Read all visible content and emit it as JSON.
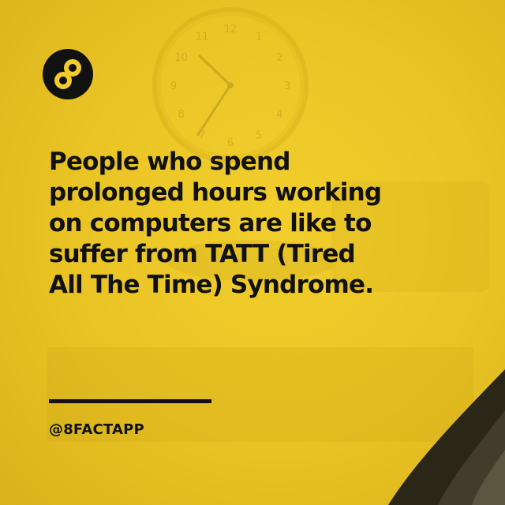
{
  "logo": {
    "icon": "infinity-8-icon",
    "background": "#111111",
    "mark_color": "#f2cc2a"
  },
  "fact": {
    "lines": [
      "People who spend",
      "prolonged hours working",
      "on computers are like to",
      "suffer from TATT (Tired",
      "All The Time) Syndrome."
    ]
  },
  "handle": "@8FACTAPP",
  "background": {
    "description_icon": "wall-clock-icon",
    "clock_numbers": [
      "12",
      "1",
      "2",
      "3",
      "4",
      "5",
      "6",
      "7",
      "8",
      "9",
      "10",
      "11"
    ]
  },
  "colors": {
    "accent": "#f2cc2a",
    "text": "#111111"
  }
}
